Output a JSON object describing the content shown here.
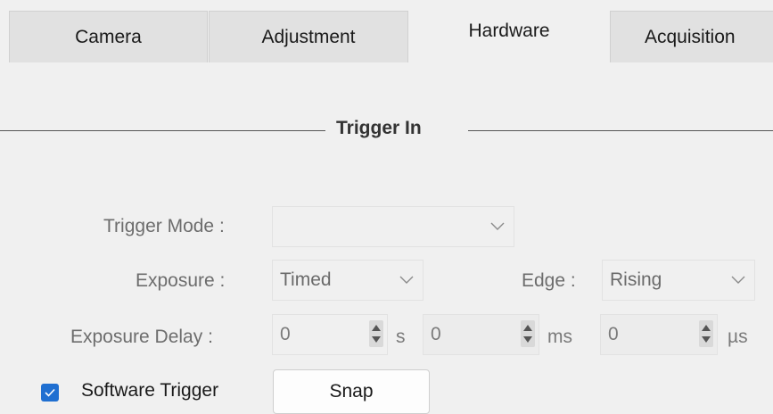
{
  "tabs": [
    "Camera",
    "Adjustment",
    "Hardware",
    "Acquisition"
  ],
  "active_tab": "Hardware",
  "group_title": "Trigger In",
  "trigger_mode": {
    "label": "Trigger Mode :",
    "value": ""
  },
  "exposure": {
    "label": "Exposure :",
    "value": "Timed"
  },
  "edge": {
    "label": "Edge :",
    "value": "Rising"
  },
  "exposure_delay": {
    "label": "Exposure Delay :",
    "seconds": {
      "value": "0",
      "unit": "s"
    },
    "milliseconds": {
      "value": "0",
      "unit": "ms"
    },
    "microseconds": {
      "value": "0",
      "unit": "µs"
    }
  },
  "software_trigger": {
    "label": "Software Trigger",
    "checked": true
  },
  "snap_button": "Snap",
  "colors": {
    "accent": "#1f6fd1",
    "background": "#f0f0f0",
    "tab_inactive": "#e1e1e1"
  },
  "icons": [
    "chevron-down-icon",
    "spin-arrows-icon",
    "checkmark-icon"
  ]
}
